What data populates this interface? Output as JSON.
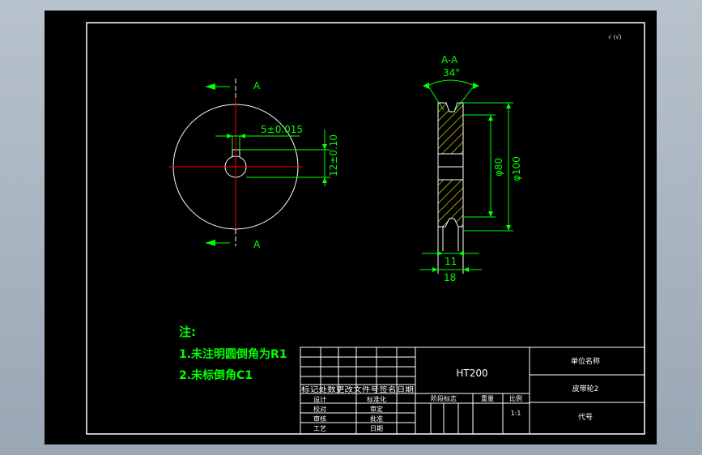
{
  "view": {
    "section_label": "A-A",
    "groove_angle": "34°",
    "cut_mark_top": "A",
    "cut_mark_bottom": "A",
    "roughness_symbol": "√ (√)",
    "dimensions": {
      "keyway_width": "5±0.015",
      "keyway_depth": "12±0.10",
      "dia_80": "φ80",
      "dia_100": "φ100",
      "hub_width": "11",
      "total_width": "18"
    }
  },
  "notes": {
    "heading": "注:",
    "line1": "1.未注明圆倒角为R1",
    "line2": "2.未标倒角C1"
  },
  "title_block": {
    "material": "HT200",
    "company": "单位名称",
    "part_name": "皮带轮2",
    "code": "代号",
    "header_row": "标记处数更改文件号签名日期",
    "row_design": "设计",
    "row_standard": "标准化",
    "row_check": "校对",
    "row_review": "审定",
    "row_audit": "审核",
    "row_approve": "批准",
    "row_process": "工艺",
    "row_date": "日期",
    "stage_mark": "阶段标志",
    "weight": "重量",
    "scale_label": "比例",
    "scale_value": "1:1"
  }
}
